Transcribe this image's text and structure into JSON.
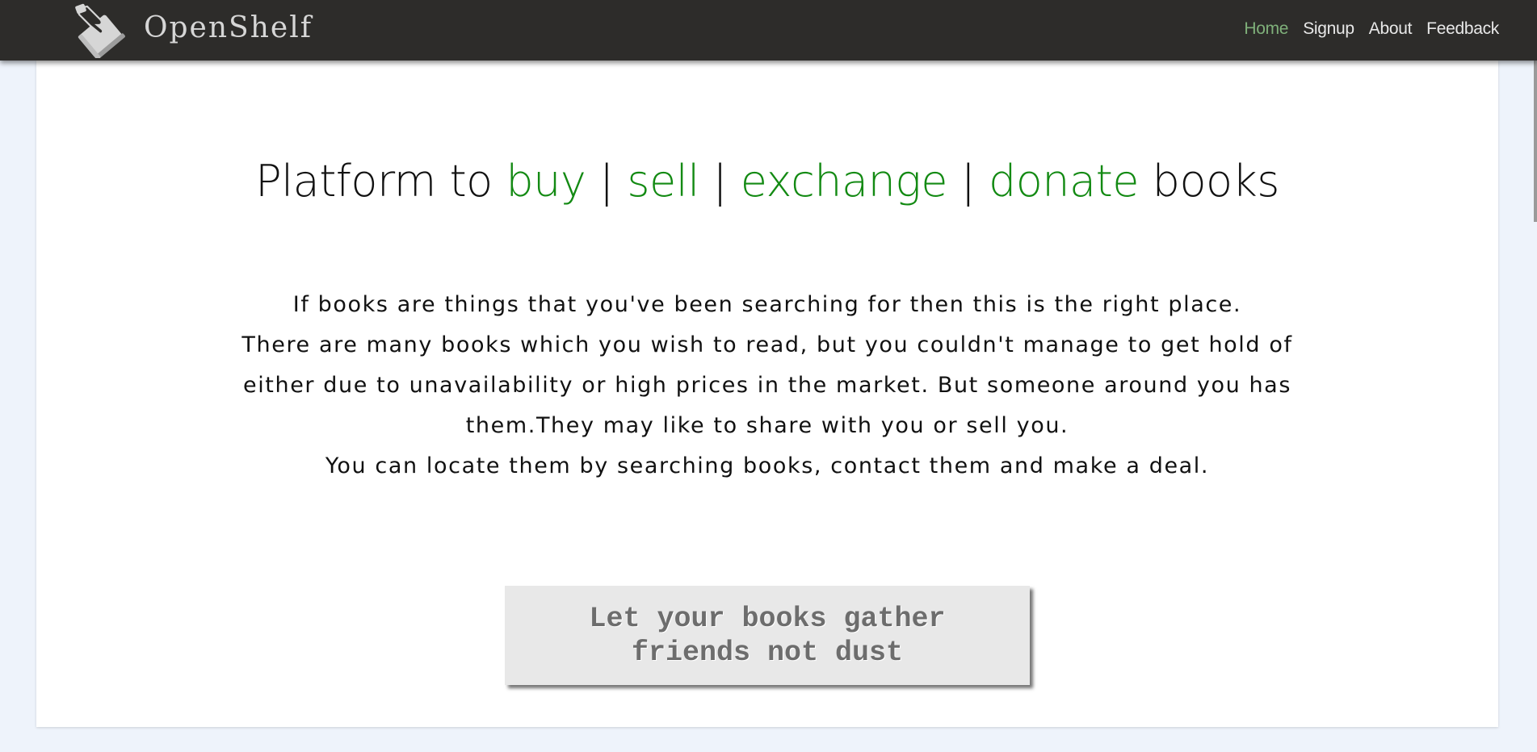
{
  "brand": {
    "name": "OpenShelf",
    "logo_icon": "hand-holding-book-icon"
  },
  "nav": {
    "items": [
      {
        "label": "Home",
        "active": true
      },
      {
        "label": "Signup",
        "active": false
      },
      {
        "label": "About",
        "active": false
      },
      {
        "label": "Feedback",
        "active": false
      }
    ]
  },
  "hero": {
    "prefix": "Platform to ",
    "actions": [
      "buy",
      "sell",
      "exchange",
      "donate"
    ],
    "separator": "|",
    "suffix": "books",
    "accent_color": "#138a13"
  },
  "intro": {
    "line1": "If books are things that you've been searching for then this is the right place.",
    "line2": "There are many books which you wish to read, but you couldn't manage to get hold of",
    "line3": "either due to unavailability or high prices in the market. But someone around you has",
    "line4": "them.They may like to share with you or sell you.",
    "line5": "You can locate them by searching books, contact them and make a deal."
  },
  "cta": {
    "line1": "Let your books gather",
    "line2": "friends not dust"
  },
  "colors": {
    "navbar": "#2d2c2a",
    "page_background": "#eef3fb",
    "nav_active": "#7fb07a"
  }
}
